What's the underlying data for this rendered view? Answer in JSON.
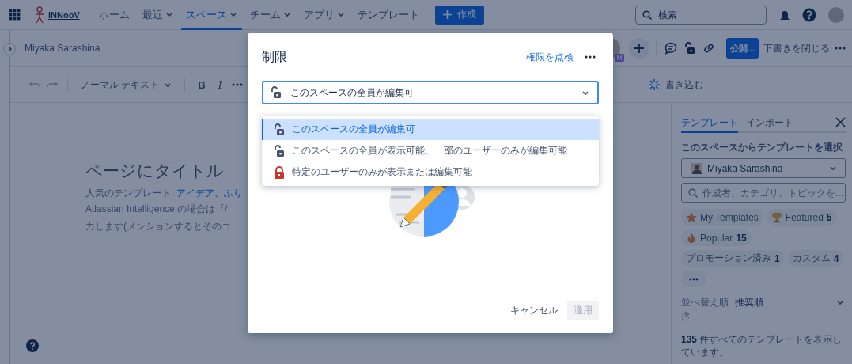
{
  "topnav": {
    "logo": "INNooV",
    "items": [
      {
        "label": "ホーム",
        "dropdown": false,
        "selected": false
      },
      {
        "label": "最近",
        "dropdown": true,
        "selected": false
      },
      {
        "label": "スペース",
        "dropdown": true,
        "selected": true
      },
      {
        "label": "チーム",
        "dropdown": true,
        "selected": false
      },
      {
        "label": "アプリ",
        "dropdown": true,
        "selected": false
      },
      {
        "label": "テンプレート",
        "dropdown": false,
        "selected": false
      }
    ],
    "create_button": "作成",
    "search": {
      "placeholder": "検索"
    }
  },
  "editor": {
    "breadcrumb": "Miyaka Sarashina",
    "collaborator_badge": "M",
    "publish_button": "公開...",
    "close_draft": "下書きを閉じる",
    "toolbar": {
      "text_style": "ノーマル テキスト",
      "bold": "B",
      "italic": "I",
      "write_button": "書き込む"
    },
    "title_field": {
      "placeholder": "ページにタイトル"
    },
    "popular_label": "人気のテンプレート: ",
    "popular_links": "アイデア、ふり",
    "hint_lines": [
      "Atlassian Intelligence の場合は「/",
      "力します(メンションするとそのコ"
    ]
  },
  "template_panel": {
    "tabs": [
      {
        "label": "テンプレート",
        "selected": true
      },
      {
        "label": "インポート",
        "selected": false
      }
    ],
    "space_label": "このスペースからテンプレートを選択",
    "space_select": "Miyaka Sarashina",
    "search": {
      "placeholder": "作成者、カテゴリ、トピックを..."
    },
    "chips": [
      {
        "kind": "star",
        "label": "My Templates"
      },
      {
        "kind": "trophy",
        "label": "Featured",
        "count": "5"
      },
      {
        "kind": "fire",
        "label": "Popular",
        "count": "15"
      },
      {
        "kind": "plain",
        "label": "プロモーション済み",
        "count": "1"
      },
      {
        "kind": "plain",
        "label": "カスタム",
        "count": "4"
      }
    ],
    "sort_label": "並べ替え順序",
    "sort_value": "推奨順",
    "summary": "**135** 件すべてのテンプレートを表示しています。"
  },
  "modal": {
    "title": "制限",
    "check_link": "権限を点検",
    "select_value": "このスペースの全員が編集可",
    "options": [
      {
        "kind": "unlocked",
        "label": "このスペースの全員が編集可",
        "selected": true
      },
      {
        "kind": "unlocked",
        "label": "このスペースの全員が表示可能、一部のユーザーのみが編集可能",
        "selected": false
      },
      {
        "kind": "locked",
        "label": "特定のユーザーのみが表示または編集可能",
        "selected": false
      }
    ],
    "cancel_button": "キャンセル",
    "apply_button": {
      "label": "適用",
      "disabled": true
    }
  }
}
